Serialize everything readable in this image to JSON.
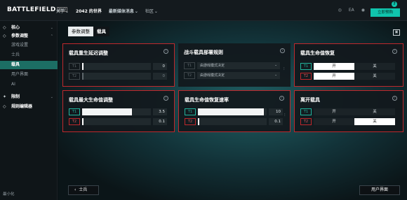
{
  "header": {
    "logo": "BATTLEFIELD",
    "logo_badge": "2042",
    "nav": [
      {
        "label": "关于",
        "chevron": true
      },
      {
        "label": "2042 的世界",
        "chevron": false
      },
      {
        "label": "最新媒体消息",
        "chevron": true
      },
      {
        "label": "社区",
        "chevron": true
      }
    ],
    "icons": [
      "globe-icon",
      "ea-icon",
      "user-icon"
    ],
    "join_label": "立即预购",
    "help_label": "?"
  },
  "sidebar": {
    "items": [
      {
        "label": "核心",
        "symbol": "◇",
        "arrow": "⌄",
        "kind": "bold"
      },
      {
        "label": "参数调整",
        "symbol": "◇",
        "arrow": "⌃",
        "kind": "bold"
      },
      {
        "label": "游戏设置",
        "kind": "sub"
      },
      {
        "label": "士兵",
        "kind": "sub"
      },
      {
        "label": "载具",
        "kind": "active"
      },
      {
        "label": "用户界面",
        "kind": "sub"
      },
      {
        "label": "AI",
        "kind": "sub"
      },
      {
        "label": "限制",
        "symbol": "✦",
        "arrow": "⌄",
        "kind": "bold"
      },
      {
        "label": "规则编辑器",
        "symbol": "◇",
        "kind": "bold"
      }
    ],
    "minimize_label": "最小化"
  },
  "breadcrumb": {
    "parent": "参数调整",
    "current": "载具"
  },
  "panels": {
    "respawn": {
      "title": "载具重生延迟调整",
      "rows": [
        {
          "tag": "T1",
          "value": "0",
          "fill": 0.0,
          "dim": false
        },
        {
          "tag": "T2",
          "value": "0",
          "fill": 0.0,
          "dim": true
        }
      ]
    },
    "deploy": {
      "title": "战斗载具部署规则",
      "rows": [
        {
          "tag": "T1",
          "value": "由游戏模式决定"
        },
        {
          "tag": "T2",
          "value": "由游戏模式决定"
        }
      ]
    },
    "heal": {
      "title": "载具生命值恢复",
      "rows": [
        {
          "tag": "T1",
          "on": "开",
          "off": "关"
        },
        {
          "tag": "T2",
          "on": "开",
          "off": "关"
        }
      ]
    },
    "maxhp": {
      "title": "载具最大生命值调整",
      "rows": [
        {
          "tag": "T1",
          "value": "3.5",
          "fill": 0.72
        },
        {
          "tag": "T2",
          "value": "0.1",
          "fill": 0.0
        }
      ]
    },
    "regen": {
      "title": "载具生命值恢复速率",
      "rows": [
        {
          "tag": "T1",
          "value": "10",
          "fill": 0.96
        },
        {
          "tag": "T2",
          "value": "0.1",
          "fill": 0.0
        }
      ]
    },
    "leave": {
      "title": "离开载具",
      "rows": [
        {
          "tag": "T1",
          "on": "开",
          "off": "关"
        },
        {
          "tag": "T2",
          "on": "开",
          "off": "关"
        }
      ]
    }
  },
  "footer": {
    "back_label": "士兵",
    "next_label": "用户界面"
  },
  "colors": {
    "accent": "#10c4ad",
    "team1": "#22b59e",
    "team2": "#c0282c",
    "highlight": "#c0282c"
  }
}
